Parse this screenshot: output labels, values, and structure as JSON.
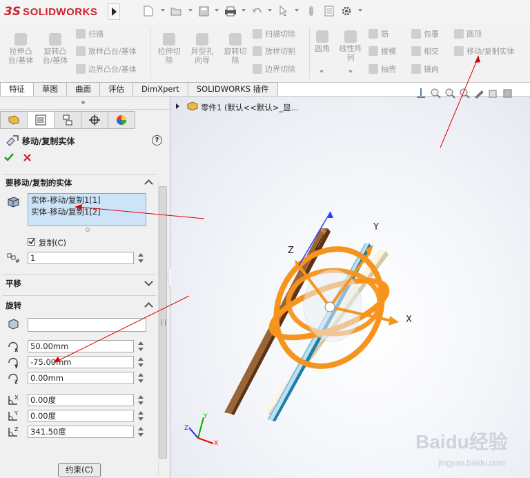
{
  "app": {
    "brand_ds": "3S",
    "brand_name": "SOLIDWORKS"
  },
  "ribbon": {
    "items": [
      {
        "id": "extrude-boss",
        "label": "拉伸凸\n台/基体"
      },
      {
        "id": "revolve-boss",
        "label": "旋转凸\n台/基体"
      },
      {
        "id": "sweep",
        "label": "扫描"
      },
      {
        "id": "loft",
        "label": "放样凸台/基体"
      },
      {
        "id": "boundary-boss",
        "label": "边界凸台/基体"
      },
      {
        "id": "extrude-cut",
        "label": "拉伸切\n除"
      },
      {
        "id": "hole-wizard",
        "label": "异型孔\n向导"
      },
      {
        "id": "revolve-cut",
        "label": "旋转切\n除"
      },
      {
        "id": "sweep-cut",
        "label": "扫描切除"
      },
      {
        "id": "loft-cut",
        "label": "放样切割"
      },
      {
        "id": "boundary-cut",
        "label": "边界切除"
      },
      {
        "id": "fillet",
        "label": "圆角"
      },
      {
        "id": "linear-pattern",
        "label": "线性阵\n列"
      },
      {
        "id": "rib",
        "label": "筋"
      },
      {
        "id": "draft",
        "label": "拔模"
      },
      {
        "id": "shell",
        "label": "抽壳"
      },
      {
        "id": "wrap",
        "label": "包覆"
      },
      {
        "id": "intersect",
        "label": "相交"
      },
      {
        "id": "mirror",
        "label": "镜向"
      },
      {
        "id": "dome",
        "label": "圆顶"
      },
      {
        "id": "move-copy",
        "label": "移动/复制实体"
      }
    ]
  },
  "tabs": [
    {
      "label": "特征",
      "active": true
    },
    {
      "label": "草图"
    },
    {
      "label": "曲面"
    },
    {
      "label": "评估"
    },
    {
      "label": "DimXpert"
    },
    {
      "label": "SOLIDWORKS 插件"
    }
  ],
  "feature": {
    "title": "移动/复制实体",
    "help": "?",
    "ok_icon": "check-icon",
    "cancel_icon": "x-icon"
  },
  "bodies_section": {
    "title": "要移动/复制的实体",
    "items": [
      "实体-移动/复制1[1]",
      "实体-移动/复制1[2]"
    ],
    "copy_label": "复制(C)",
    "copy_checked": true,
    "copies": "1"
  },
  "translate_section": {
    "title": "平移"
  },
  "rotate_section": {
    "title": "旋转",
    "origin_value": "",
    "x": "50.00mm",
    "y": "-75.00mm",
    "z": "0.00mm",
    "angle_x": "0.00度",
    "angle_y": "0.00度",
    "angle_z": "341.50度"
  },
  "footer": {
    "end_button": "约束(C)"
  },
  "tree": {
    "part_label": "零件1  (默认<<默认>_显..."
  },
  "triad": {
    "x": "X",
    "y": "Y",
    "z": "Z"
  },
  "view_triad": {
    "x": "X",
    "y": "Y",
    "z": "Z"
  },
  "watermark": {
    "brand": "Baidu经验",
    "url": "jingyan.baidu.com"
  },
  "colors": {
    "accent": "#f7941d",
    "brand_red": "#d0202a",
    "selection": "#cde3f7",
    "annotation": "#e00000"
  }
}
